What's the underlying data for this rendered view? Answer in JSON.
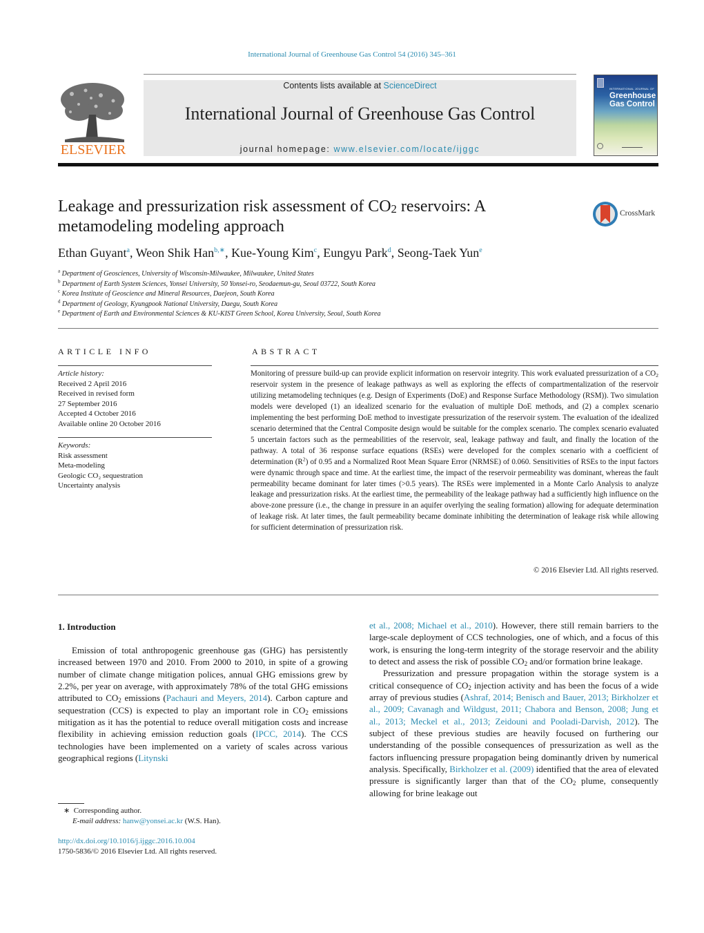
{
  "running_head": "International Journal of Greenhouse Gas Control 54 (2016) 345–361",
  "masthead": {
    "publisher_logo_text": "ELSEVIER",
    "contents_prefix": "Contents lists available at ",
    "contents_link": "ScienceDirect",
    "journal_title": "International Journal of Greenhouse Gas Control",
    "homepage_prefix": "journal homepage: ",
    "homepage_link": "www.elsevier.com/locate/ijggc",
    "cover_small": "INTERNATIONAL JOURNAL OF",
    "cover_title": "Greenhouse Gas Control"
  },
  "article": {
    "title_part1": "Leakage and pressurization risk assessment of CO",
    "title_sub": "2",
    "title_part2": " reservoirs: A metamodeling modeling approach",
    "crossmark_label": "CrossMark",
    "authors": [
      {
        "name": "Ethan Guyant",
        "sup": "a"
      },
      {
        "name": "Weon Shik Han",
        "sup": "b,∗"
      },
      {
        "name": "Kue-Young Kim",
        "sup": "c"
      },
      {
        "name": "Eungyu Park",
        "sup": "d"
      },
      {
        "name": "Seong-Taek Yun",
        "sup": "e"
      }
    ],
    "affiliations": [
      {
        "key": "a",
        "text": "Department of Geosciences, University of Wisconsin-Milwaukee, Milwaukee, United States"
      },
      {
        "key": "b",
        "text": "Department of Earth System Sciences, Yonsei University, 50 Yonsei-ro, Seodaemun-gu, Seoul 03722, South Korea"
      },
      {
        "key": "c",
        "text": "Korea Institute of Geoscience and Mineral Resources, Daejeon, South Korea"
      },
      {
        "key": "d",
        "text": "Department of Geology, Kyungpook National University, Daegu, South Korea"
      },
      {
        "key": "e",
        "text": "Department of Earth and Environmental Sciences & KU-KIST Green School, Korea University, Seoul, South Korea"
      }
    ]
  },
  "article_info": {
    "heading": "ARTICLE INFO",
    "history_label": "Article history:",
    "history": [
      "Received 2 April 2016",
      "Received in revised form",
      "27 September 2016",
      "Accepted 4 October 2016",
      "Available online 20 October 2016"
    ],
    "keywords_label": "Keywords:",
    "keywords": [
      "Risk assessment",
      "Meta-modeling",
      "Geologic CO₂ sequestration",
      "Uncertainty analysis"
    ]
  },
  "abstract": {
    "heading": "ABSTRACT",
    "p1": "Monitoring of pressure build-up can provide explicit information on reservoir integrity. This work evaluated pressurization of a CO",
    "p1_sub": "2",
    "p2": " reservoir system in the presence of leakage pathways as well as exploring the effects of compartmentalization of the reservoir utilizing metamodeling techniques (e.g. Design of Experiments (DoE) and Response Surface Methodology (RSM)). Two simulation models were developed (1) an idealized scenario for the evaluation of multiple DoE methods, and (2) a complex scenario implementing the best performing DoE method to investigate pressurization of the reservoir system. The evaluation of the idealized scenario determined that the Central Composite design would be suitable for the complex scenario. The complex scenario evaluated 5 uncertain factors such as the permeabilities of the reservoir, seal, leakage pathway and fault, and finally the location of the pathway. A total of 36 response surface equations (RSEs) were developed for the complex scenario with a coefficient of determination (R",
    "p2_sup": "2",
    "p3": ") of 0.95 and a Normalized Root Mean Square Error (NRMSE) of 0.060. Sensitivities of RSEs to the input factors were dynamic through space and time. At the earliest time, the impact of the reservoir permeability was dominant, whereas the fault permeability became dominant for later times (>0.5 years). The RSEs were implemented in a Monte Carlo Analysis to analyze leakage and pressurization risks. At the earliest time, the permeability of the leakage pathway had a sufficiently high influence on the above-zone pressure (i.e., the change in pressure in an aquifer overlying the sealing formation) allowing for adequate determination of leakage risk. At later times, the fault permeability became dominate inhibiting the determination of leakage risk while allowing for sufficient determination of pressurization risk.",
    "copyright": "© 2016 Elsevier Ltd. All rights reserved."
  },
  "intro": {
    "heading": "1.  Introduction",
    "left": {
      "t1": "Emission of total anthropogenic greenhouse gas (GHG) has persistently increased between 1970 and 2010. From 2000 to 2010, in spite of a growing number of climate change mitigation polices, annual GHG emissions grew by 2.2%, per year on average, with approximately 78% of the total GHG emissions attributed to CO",
      "t2": " emissions (",
      "ref1": "Pachauri and Meyers, 2014",
      "t3": "). Carbon capture and sequestration (CCS) is expected to play an important role in CO",
      "t4": " emissions mitigation as it has the potential to reduce overall mitigation costs and increase flexibility in achieving emission reduction goals (",
      "ref2": "IPCC, 2014",
      "t5": "). The CCS technologies have been implemented on a variety of scales across various geographical regions (",
      "ref3": "Litynski"
    },
    "right": {
      "ref3b": "et al., 2008; Michael et al., 2010",
      "t1": "). However, there still remain barriers to the large-scale deployment of CCS technologies, one of which, and a focus of this work, is ensuring the long-term integrity of the storage reservoir and the ability to detect and assess the risk of possible CO",
      "t2": " and/or formation brine leakage.",
      "p2a": "Pressurization and pressure propagation within the storage system is a critical consequence of CO",
      "p2b": " injection activity and has been the focus of a wide array of previous studies (",
      "ref4": "Ashraf, 2014; Benisch and Bauer, 2013; Birkholzer et al., 2009; Cavanagh and Wildgust, 2011; Chabora and Benson, 2008; Jung et al., 2013; Meckel et al., 2013; Zeidouni and Pooladi-Darvish, 2012",
      "p2c": "). The subject of these previous studies are heavily focused on furthering our understanding of the possible consequences of pressurization as well as the factors influencing pressure propagation being dominantly driven by numerical analysis. Specifically, ",
      "ref5": "Birkholzer et al. (2009)",
      "p2d": " identified that the area of elevated pressure is significantly larger than that of the CO",
      "p2e": " plume, consequently allowing for brine leakage out"
    },
    "sub2": "2"
  },
  "footnotes": {
    "corresponding_mark": "∗",
    "corresponding": "Corresponding author.",
    "email_label": "E-mail address:",
    "email": "hanw@yonsei.ac.kr",
    "email_suffix": " (W.S. Han).",
    "doi": "http://dx.doi.org/10.1016/j.ijggc.2016.10.004",
    "issn_line": "1750-5836/© 2016 Elsevier Ltd. All rights reserved."
  }
}
